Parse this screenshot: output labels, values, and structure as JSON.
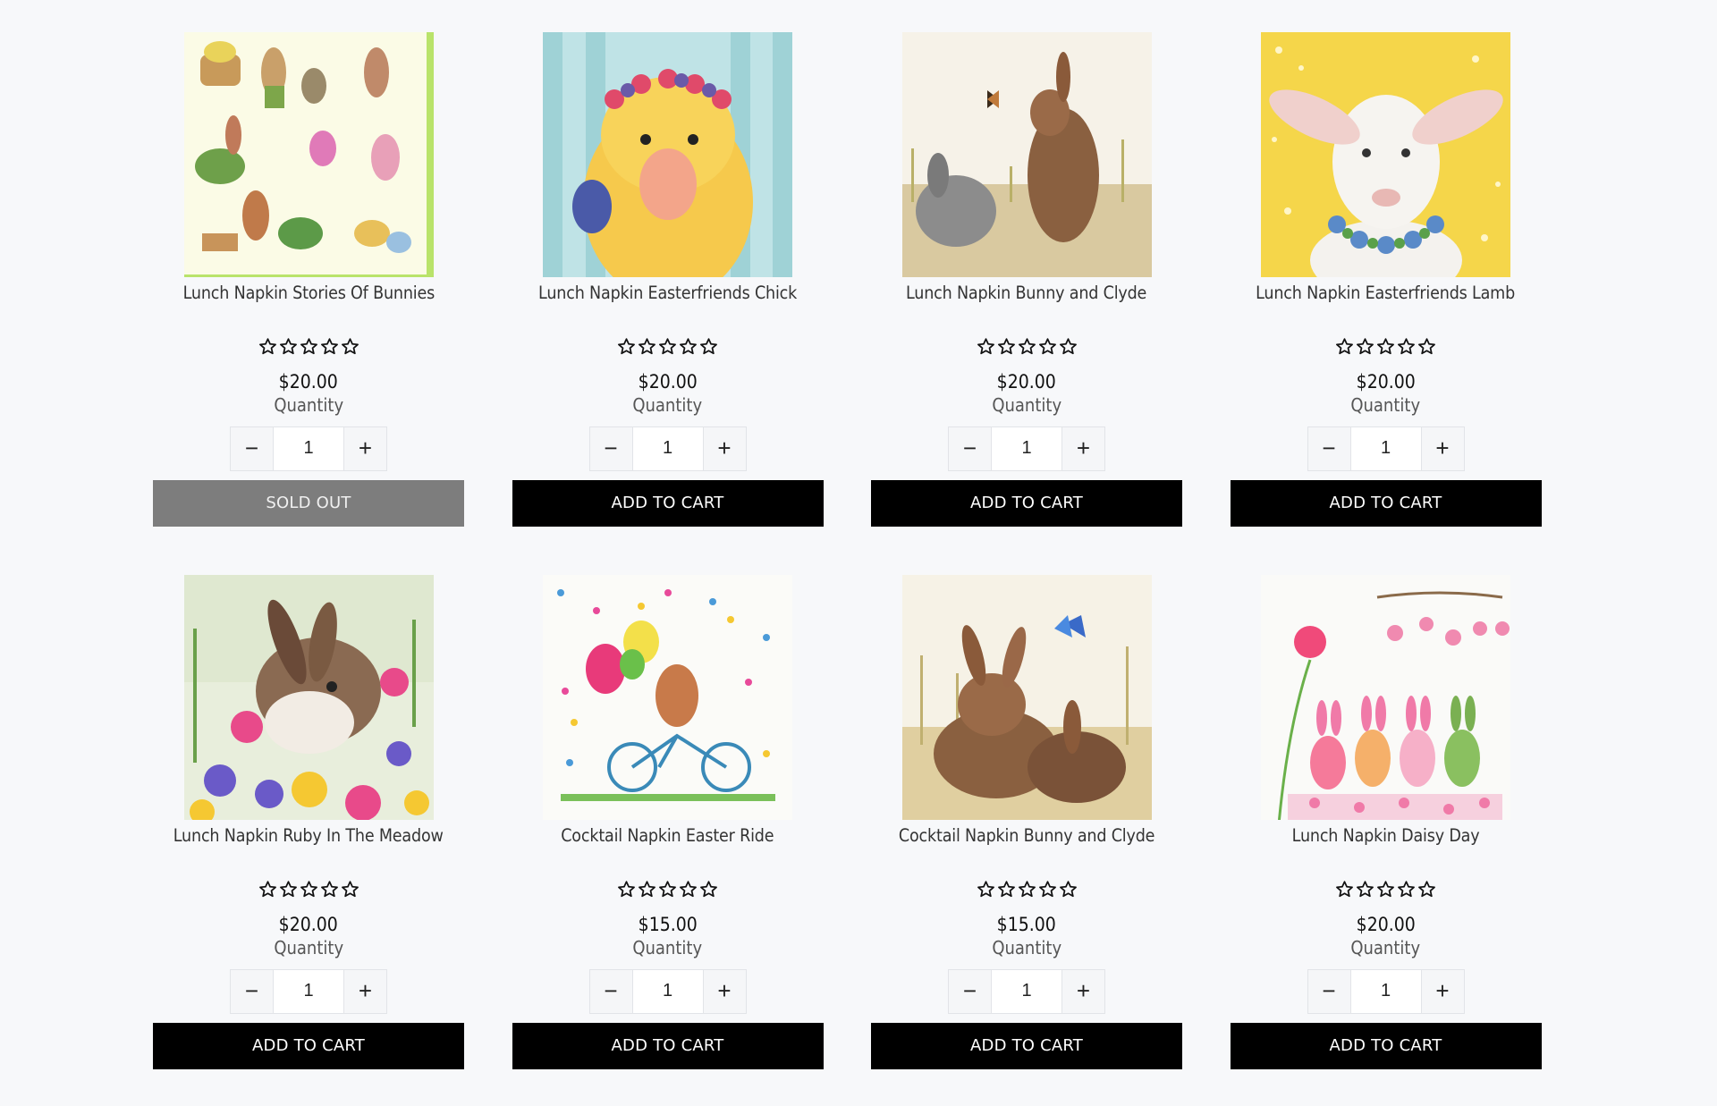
{
  "products": [
    {
      "title": "Lunch Napkin Stories Of Bunnies",
      "price": "$20.00",
      "quantity_label": "Quantity",
      "quantity": "1",
      "button_label": "SOLD OUT",
      "sold_out": true,
      "rating": 0,
      "image": "bunny-stories-illustration"
    },
    {
      "title": "Lunch Napkin Easterfriends Chick",
      "price": "$20.00",
      "quantity_label": "Quantity",
      "quantity": "1",
      "button_label": "ADD TO CART",
      "sold_out": false,
      "rating": 0,
      "image": "chick-with-flower-crown"
    },
    {
      "title": "Lunch Napkin Bunny and Clyde",
      "price": "$20.00",
      "quantity_label": "Quantity",
      "quantity": "1",
      "button_label": "ADD TO CART",
      "sold_out": false,
      "rating": 0,
      "image": "two-bunnies-butterfly"
    },
    {
      "title": "Lunch Napkin Easterfriends Lamb",
      "price": "$20.00",
      "quantity_label": "Quantity",
      "quantity": "1",
      "button_label": "ADD TO CART",
      "sold_out": false,
      "rating": 0,
      "image": "lamb-flower-wreath"
    },
    {
      "title": "Lunch Napkin Ruby In The Meadow",
      "price": "$20.00",
      "quantity_label": "Quantity",
      "quantity": "1",
      "button_label": "ADD TO CART",
      "sold_out": false,
      "rating": 0,
      "image": "bunny-in-meadow"
    },
    {
      "title": "Cocktail Napkin Easter Ride",
      "price": "$15.00",
      "quantity_label": "Quantity",
      "quantity": "1",
      "button_label": "ADD TO CART",
      "sold_out": false,
      "rating": 0,
      "image": "bunny-on-bicycle"
    },
    {
      "title": "Cocktail Napkin Bunny and Clyde",
      "price": "$15.00",
      "quantity_label": "Quantity",
      "quantity": "1",
      "button_label": "ADD TO CART",
      "sold_out": false,
      "rating": 0,
      "image": "two-bunnies-resting"
    },
    {
      "title": "Lunch Napkin Daisy Day",
      "price": "$20.00",
      "quantity_label": "Quantity",
      "quantity": "1",
      "button_label": "ADD TO CART",
      "sold_out": false,
      "rating": 0,
      "image": "patterned-bunnies-daisies"
    }
  ],
  "icons": {
    "minus": "minus-icon",
    "plus": "plus-icon",
    "star": "star-outline-icon"
  },
  "colors": {
    "background": "#f7f8fa",
    "button": "#000000",
    "sold_out_button": "#7d7d7d",
    "button_text": "#ffffff"
  }
}
